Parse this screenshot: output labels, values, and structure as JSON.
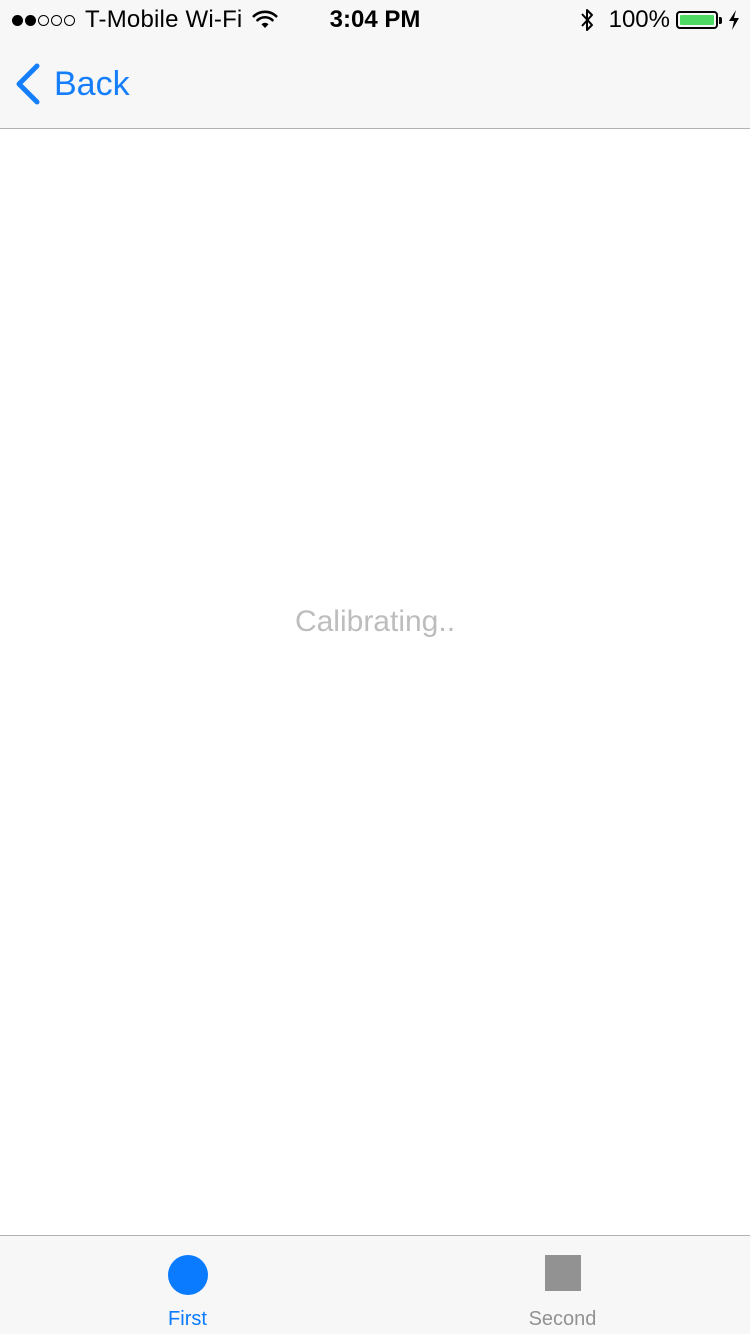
{
  "status_bar": {
    "signal_dots_filled": 2,
    "signal_dots_total": 5,
    "carrier": "T-Mobile Wi-Fi",
    "wifi_icon": "wifi-icon",
    "time": "3:04 PM",
    "bluetooth_icon": "bluetooth-icon",
    "battery_percent": "100%",
    "battery_level": 1.0,
    "battery_color": "#4cd964",
    "charging_icon": "charging-bolt-icon"
  },
  "nav_bar": {
    "back_label": "Back",
    "back_icon": "chevron-left-icon",
    "accent_color": "#157efb"
  },
  "content": {
    "status_text": "Calibrating.."
  },
  "tab_bar": {
    "tabs": [
      {
        "label": "First",
        "icon": "circle-icon",
        "selected": true,
        "color": "#0a7bff"
      },
      {
        "label": "Second",
        "icon": "square-icon",
        "selected": false,
        "color": "#929292"
      }
    ]
  }
}
